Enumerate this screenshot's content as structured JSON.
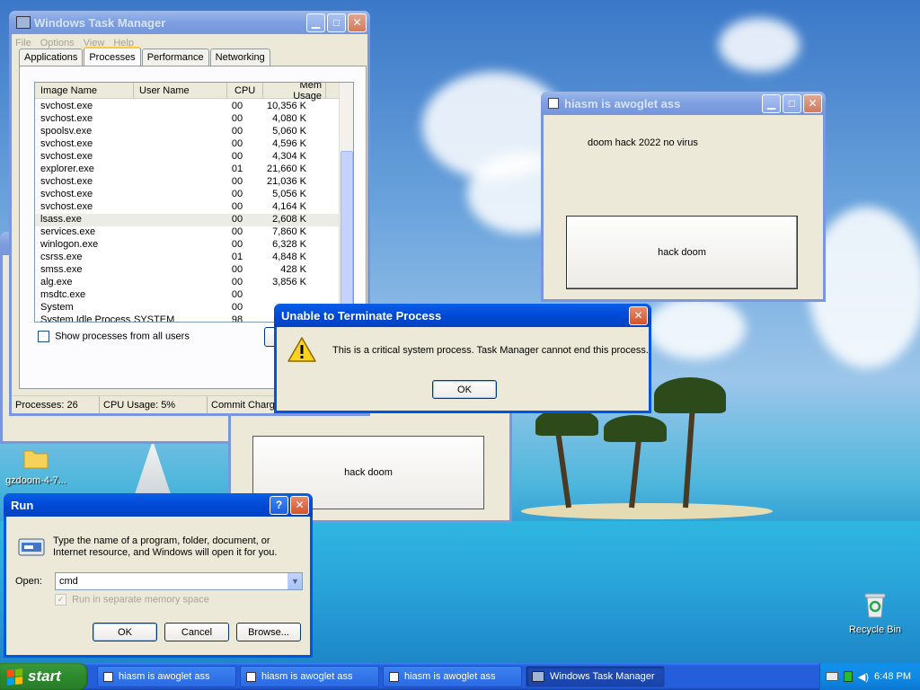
{
  "desktop": {
    "icons": [
      {
        "label": "gzdoom-4-7...",
        "icon": "folder-icon"
      },
      {
        "label": "Recycle Bin",
        "icon": "recycle-bin-icon"
      }
    ]
  },
  "task_manager": {
    "title": "Windows Task Manager",
    "menu": [
      "File",
      "Options",
      "View",
      "Help"
    ],
    "tabs": [
      "Applications",
      "Processes",
      "Performance",
      "Networking"
    ],
    "active_tab": "Processes",
    "columns": [
      "Image Name",
      "User Name",
      "CPU",
      "Mem Usage"
    ],
    "rows": [
      [
        "svchost.exe",
        "",
        "00",
        "10,356 K"
      ],
      [
        "svchost.exe",
        "",
        "00",
        "4,080 K"
      ],
      [
        "spoolsv.exe",
        "",
        "00",
        "5,060 K"
      ],
      [
        "svchost.exe",
        "",
        "00",
        "4,596 K"
      ],
      [
        "svchost.exe",
        "",
        "00",
        "4,304 K"
      ],
      [
        "explorer.exe",
        "",
        "01",
        "21,660 K"
      ],
      [
        "svchost.exe",
        "",
        "00",
        "21,036 K"
      ],
      [
        "svchost.exe",
        "",
        "00",
        "5,056 K"
      ],
      [
        "svchost.exe",
        "",
        "00",
        "4,164 K"
      ],
      [
        "lsass.exe",
        "",
        "00",
        "2,608 K"
      ],
      [
        "services.exe",
        "",
        "00",
        "7,860 K"
      ],
      [
        "winlogon.exe",
        "",
        "00",
        "6,328 K"
      ],
      [
        "csrss.exe",
        "",
        "01",
        "4,848 K"
      ],
      [
        "smss.exe",
        "",
        "00",
        "428 K"
      ],
      [
        "alg.exe",
        "",
        "00",
        "3,856 K"
      ],
      [
        "msdtc.exe",
        "",
        "00",
        ""
      ],
      [
        "System",
        "",
        "00",
        ""
      ],
      [
        "System Idle Process",
        "SYSTEM",
        "98",
        ""
      ]
    ],
    "show_all_label": "Show processes from all users",
    "status": {
      "processes": "Processes: 26",
      "cpu": "CPU Usage: 5%",
      "commit": "Commit Charge"
    }
  },
  "hack_window": {
    "title": "hiasm is awoglet ass",
    "label": "doom hack 2022 no virus",
    "button": "hack doom"
  },
  "hack_window_back": {
    "button": "hack doom"
  },
  "error_dialog": {
    "title": "Unable to Terminate Process",
    "message": "This is a critical system process.  Task Manager cannot end this process.",
    "ok": "OK"
  },
  "run_dialog": {
    "title": "Run",
    "description": "Type the name of a program, folder, document, or Internet resource, and Windows will open it for you.",
    "open_label": "Open:",
    "open_value": "cmd",
    "separate_memory": "Run in separate memory space",
    "ok": "OK",
    "cancel": "Cancel",
    "browse": "Browse..."
  },
  "taskbar": {
    "start": "start",
    "buttons": [
      {
        "label": "hiasm is awoglet ass",
        "active": false
      },
      {
        "label": "hiasm is awoglet ass",
        "active": false
      },
      {
        "label": "hiasm is awoglet ass",
        "active": false
      },
      {
        "label": "Windows Task Manager",
        "active": true
      }
    ],
    "time": "6:48 PM"
  }
}
